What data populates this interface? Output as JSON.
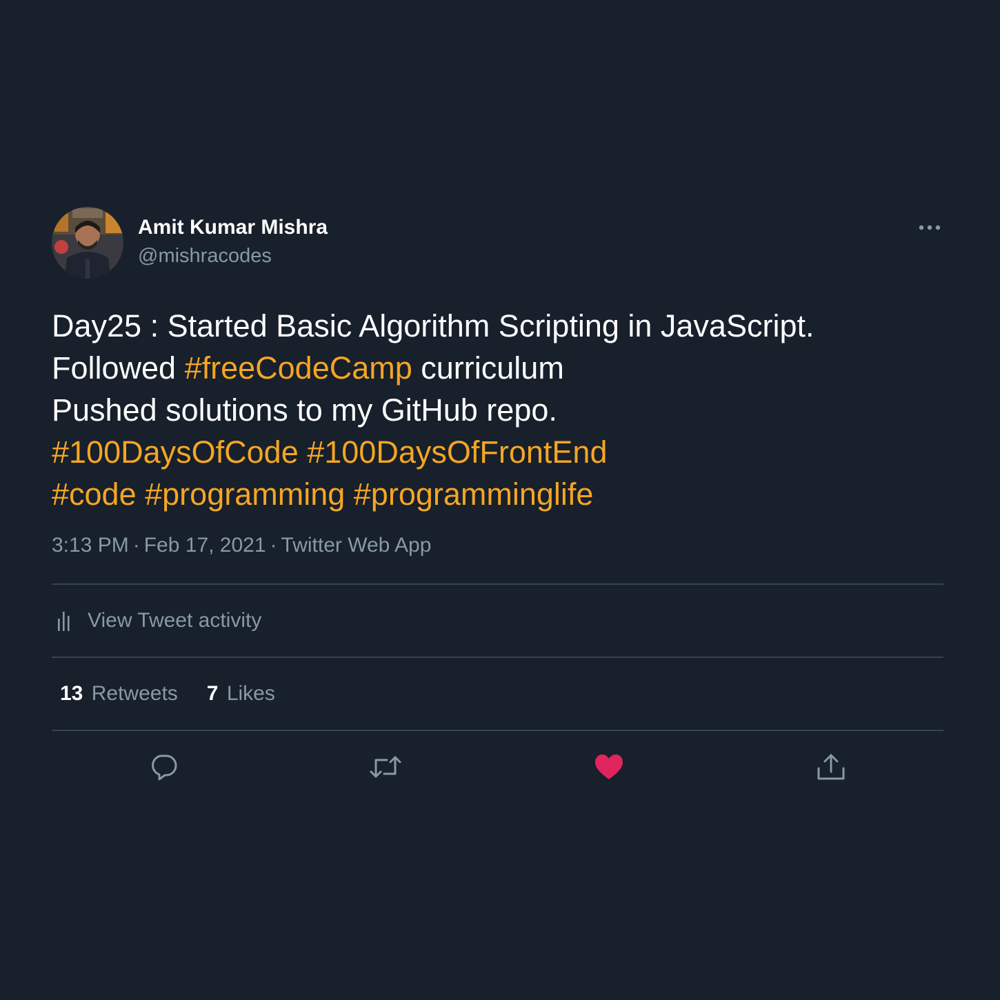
{
  "author": {
    "display_name": "Amit Kumar Mishra",
    "handle": "@mishracodes",
    "avatar_icon": "profile-photo"
  },
  "tweet": {
    "lines": [
      [
        {
          "text": "Day25 : Started Basic Algorithm Scripting in JavaScript.",
          "hashtag": false
        }
      ],
      [
        {
          "text": "Followed ",
          "hashtag": false
        },
        {
          "text": "#freeCodeCamp",
          "hashtag": true
        },
        {
          "text": " curriculum",
          "hashtag": false
        }
      ],
      [
        {
          "text": "Pushed solutions to my GitHub repo.",
          "hashtag": false
        }
      ],
      [
        {
          "text": "#100DaysOfCode",
          "hashtag": true
        },
        {
          "text": " ",
          "hashtag": false
        },
        {
          "text": "#100DaysOfFrontEnd",
          "hashtag": true
        }
      ],
      [
        {
          "text": "#code",
          "hashtag": true
        },
        {
          "text": " ",
          "hashtag": false
        },
        {
          "text": "#programming",
          "hashtag": true
        },
        {
          "text": " ",
          "hashtag": false
        },
        {
          "text": "#programminglife",
          "hashtag": true
        }
      ]
    ],
    "time": "3:13 PM",
    "separator": "·",
    "date": "Feb 17, 2021",
    "source": "Twitter Web App"
  },
  "activity": {
    "label": "View Tweet activity",
    "icon": "bar-chart-icon"
  },
  "stats": {
    "retweets_count": "13",
    "retweets_label": "Retweets",
    "likes_count": "7",
    "likes_label": "Likes"
  },
  "actions": {
    "reply_icon": "reply-icon",
    "retweet_icon": "retweet-icon",
    "like_icon": "heart-icon",
    "share_icon": "share-icon",
    "liked": true
  },
  "colors": {
    "background": "#17202b",
    "hashtag": "#f5a524",
    "secondary_text": "#8899a6",
    "divider": "#38444d",
    "like_active": "#e0245e"
  }
}
